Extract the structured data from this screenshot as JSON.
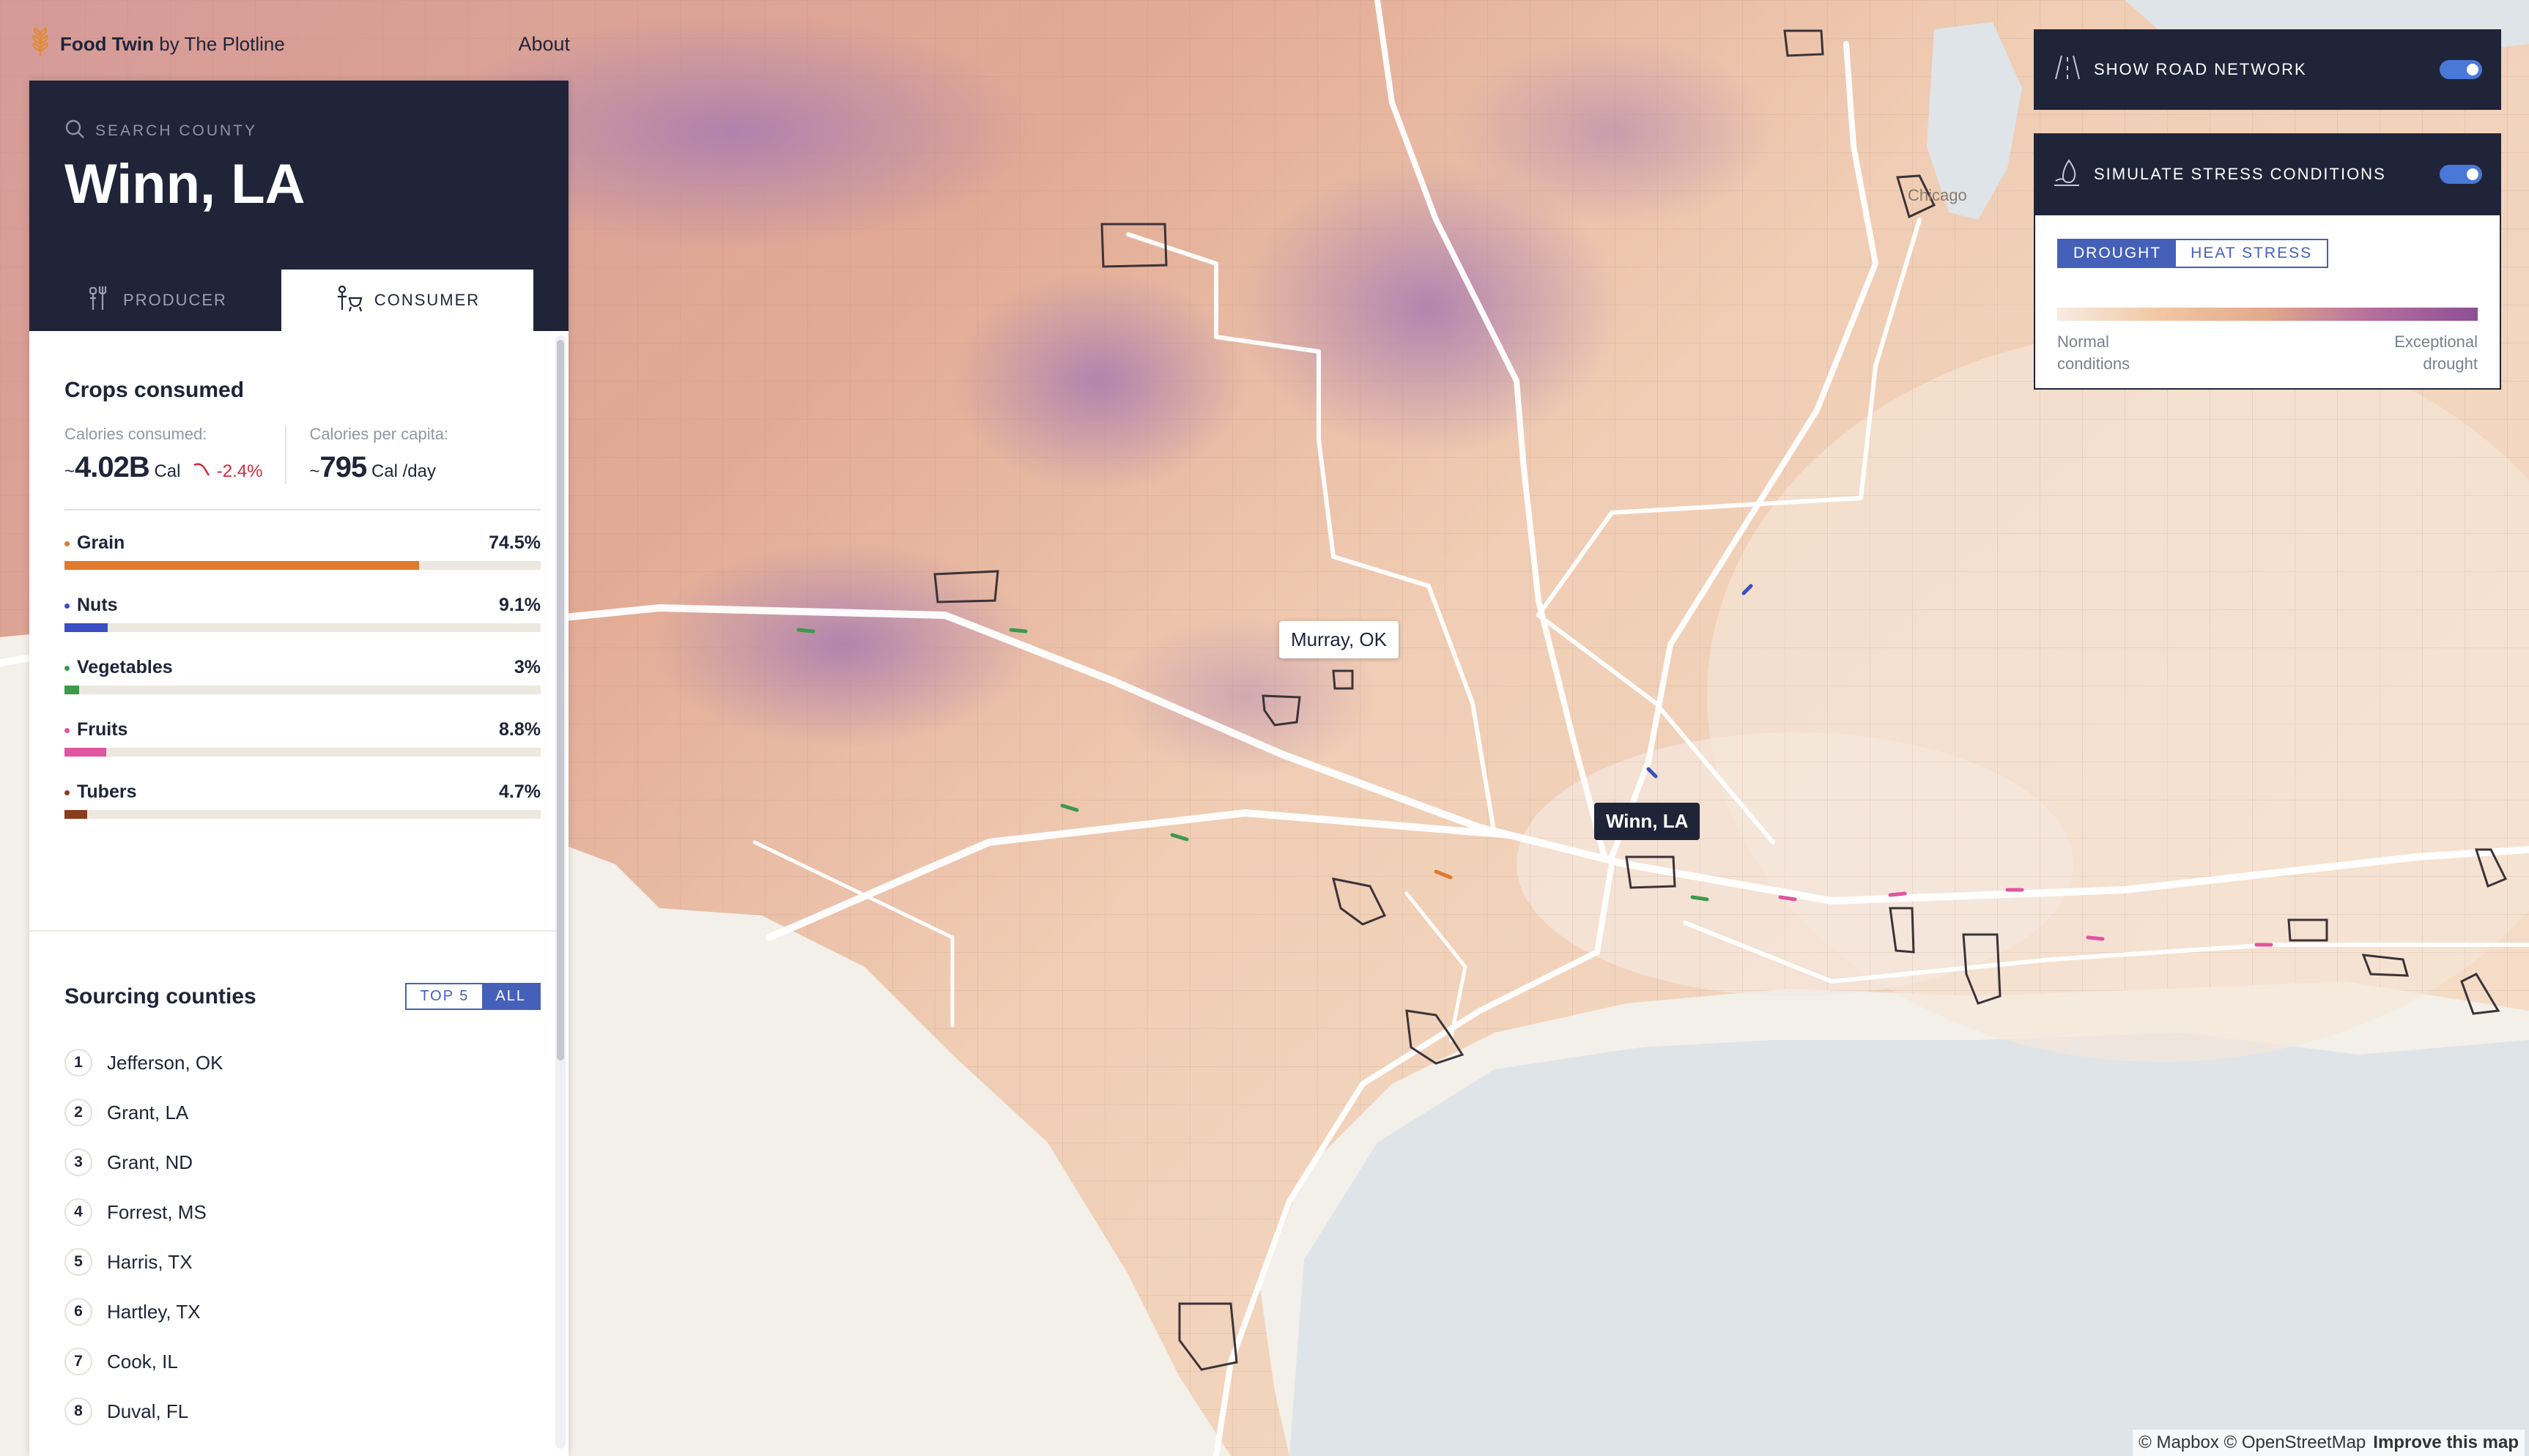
{
  "app": {
    "brand_name": "Food Twin",
    "brand_suffix": "by The Plotline",
    "about_label": "About"
  },
  "panel": {
    "search_placeholder": "SEARCH COUNTY",
    "county_title": "Winn, LA",
    "tabs": [
      {
        "label": "PRODUCER",
        "active": false
      },
      {
        "label": "CONSUMER",
        "active": true
      }
    ],
    "crops_section": {
      "title": "Crops consumed",
      "calories_consumed_label": "Calories consumed:",
      "calories_consumed_prefix": "~",
      "calories_consumed_value": "4.02B",
      "calories_consumed_unit": "Cal",
      "calories_consumed_delta": "-2.4%",
      "calories_per_capita_label": "Calories per capita:",
      "calories_per_capita_prefix": "~",
      "calories_per_capita_value": "795",
      "calories_per_capita_unit": "Cal /day",
      "crops": [
        {
          "name": "Grain",
          "percent_label": "74.5%",
          "value": 74.5,
          "color": "#e07a2e"
        },
        {
          "name": "Nuts",
          "percent_label": "9.1%",
          "value": 9.1,
          "color": "#3a4fc2"
        },
        {
          "name": "Vegetables",
          "percent_label": "3%",
          "value": 3,
          "color": "#3c9a4a"
        },
        {
          "name": "Fruits",
          "percent_label": "8.8%",
          "value": 8.8,
          "color": "#e0559f"
        },
        {
          "name": "Tubers",
          "percent_label": "4.7%",
          "value": 4.7,
          "color": "#8a3d1e"
        }
      ]
    },
    "sourcing_section": {
      "title": "Sourcing counties",
      "toggle": [
        {
          "label": "TOP 5",
          "active": false
        },
        {
          "label": "ALL",
          "active": true
        }
      ],
      "counties": [
        {
          "rank": "1",
          "name": "Jefferson, OK"
        },
        {
          "rank": "2",
          "name": "Grant, LA"
        },
        {
          "rank": "3",
          "name": "Grant, ND"
        },
        {
          "rank": "4",
          "name": "Forrest, MS"
        },
        {
          "rank": "5",
          "name": "Harris, TX"
        },
        {
          "rank": "6",
          "name": "Hartley, TX"
        },
        {
          "rank": "7",
          "name": "Cook, IL"
        },
        {
          "rank": "8",
          "name": "Duval, FL"
        }
      ]
    }
  },
  "controls": {
    "road_network": {
      "label": "SHOW ROAD NETWORK",
      "enabled": true
    },
    "stress": {
      "label": "SIMULATE STRESS CONDITIONS",
      "enabled": true
    },
    "stress_tabs": [
      {
        "label": "DROUGHT",
        "active": true
      },
      {
        "label": "HEAT STRESS",
        "active": false
      }
    ],
    "legend": {
      "low_line1": "Normal",
      "low_line2": "conditions",
      "high_line1": "Exceptional",
      "high_line2": "drought"
    }
  },
  "map": {
    "labels": {
      "hover_county": "Murray, OK",
      "selected_county": "Winn, LA",
      "city": "Chicago"
    },
    "attribution": {
      "text": "© Mapbox © OpenStreetMap",
      "improve": "Improve this map"
    },
    "colors": {
      "accent": "#4460b8",
      "dark": "#1f2438",
      "drought_low": "#f7ebe1",
      "drought_high": "#8c4f95",
      "water": "#dde4ea",
      "land_outside": "#f3efe9"
    }
  }
}
